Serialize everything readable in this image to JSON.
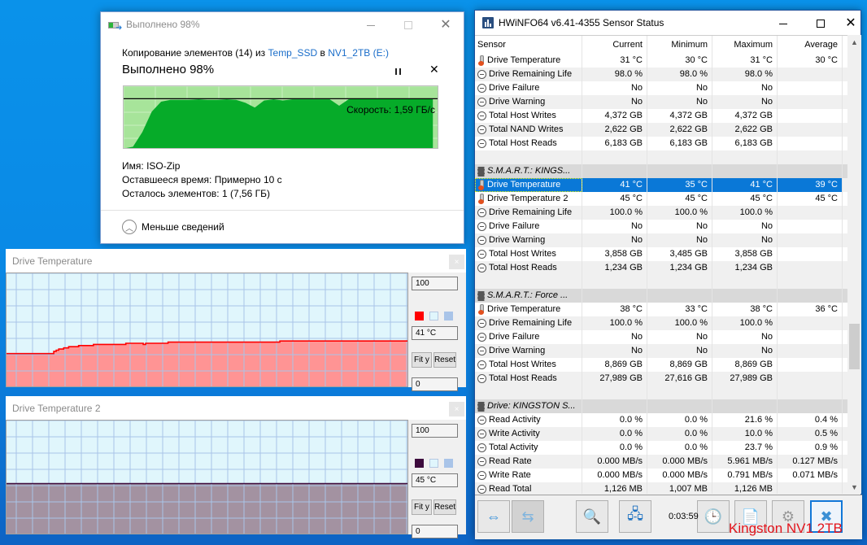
{
  "copy_dialog": {
    "title": "Выполнено 98%",
    "line_prefix": "Копирование элементов (14) из ",
    "source": "Temp_SSD",
    "line_mid": " в ",
    "destination": "NV1_2TB (E:)",
    "progress_title": "Выполнено 98%",
    "progress_percent": 98,
    "speed_label": "Скорость: 1,59 ГБ/с",
    "name_label": "Имя:",
    "name_value": "ISO-Zip",
    "time_label": "Оставшееся время:",
    "time_value": "Примерно 10 с",
    "items_label": "Осталось элементов:",
    "items_value": "1 (7,56 ГБ)",
    "less_details": "Меньше сведений",
    "speed_graph_fraction": [
      0.02,
      0.05,
      0.3,
      0.65,
      0.82,
      0.85,
      0.85,
      0.85,
      0.86,
      0.85,
      0.85,
      0.86,
      0.85,
      0.8,
      0.72,
      0.84,
      0.86,
      0.84,
      0.86,
      0.86,
      0.86,
      0.86,
      0.86,
      0.75,
      0.86,
      0.87,
      0.87,
      0.87,
      0.87,
      0.87,
      0.87,
      0.87,
      0.87,
      0.87
    ],
    "colors": {
      "graph_bg": "#a7e49a",
      "graph_fill": "#06ab29",
      "link": "#1a6dc9"
    }
  },
  "graph_windows": [
    {
      "title": "Drive Temperature",
      "max": "100",
      "current": "41 °C",
      "min": "0",
      "fit_label": "Fit y",
      "reset_label": "Reset",
      "line_color": "#ff0000",
      "fill_color": "#ff9494",
      "values": [
        30,
        30,
        30,
        30,
        30,
        30,
        30,
        30,
        30,
        30,
        30,
        30,
        30,
        30,
        30,
        30,
        30,
        30,
        30,
        32,
        33,
        34,
        34,
        35,
        35,
        36,
        36,
        36,
        36,
        37,
        37,
        37,
        37,
        37,
        37,
        38,
        38,
        38,
        38,
        38,
        38,
        38,
        38,
        38,
        38,
        38,
        38,
        38,
        39,
        39,
        39,
        39,
        39,
        39,
        39,
        38,
        39,
        39,
        39,
        39,
        39,
        39,
        39,
        39,
        39,
        40,
        40,
        40,
        40,
        40,
        40,
        40,
        40,
        40,
        40,
        40,
        40,
        40,
        40,
        40,
        40,
        40,
        40,
        40,
        40,
        40,
        40,
        40,
        40,
        40,
        40,
        40,
        40,
        40,
        40,
        40,
        40,
        40,
        40,
        40,
        40,
        40,
        40,
        40,
        40,
        40,
        40,
        40,
        40,
        40,
        41,
        41,
        41,
        41,
        41,
        41,
        41,
        41,
        41,
        41,
        41,
        41,
        41,
        41,
        41,
        41,
        41,
        41,
        41,
        41,
        41,
        41,
        41,
        41,
        41,
        41,
        41,
        41,
        41,
        41,
        41,
        41,
        41,
        41,
        41,
        41,
        41,
        41,
        41,
        41,
        41,
        41,
        41,
        41,
        41,
        41,
        41,
        41,
        41,
        41,
        41,
        41
      ]
    },
    {
      "title": "Drive Temperature 2",
      "max": "100",
      "current": "45 °C",
      "min": "0",
      "fit_label": "Fit y",
      "reset_label": "Reset",
      "line_color": "#3c0a3c",
      "fill_color": "#a392a1",
      "values": [
        45,
        45,
        45,
        45,
        45,
        45,
        45,
        45,
        45,
        45,
        45,
        45,
        45,
        45,
        45,
        45,
        45,
        45,
        45,
        45
      ]
    }
  ],
  "hwinfo": {
    "title": "HWiNFO64 v6.41-4355 Sensor Status",
    "columns": [
      "Sensor",
      "Current",
      "Minimum",
      "Maximum",
      "Average"
    ],
    "rows": [
      {
        "type": "data",
        "icon": "therm",
        "name": "Drive Temperature",
        "cur": "31 °C",
        "min": "30 °C",
        "max": "31 °C",
        "avg": "30 °C"
      },
      {
        "type": "data",
        "icon": "clock",
        "name": "Drive Remaining Life",
        "cur": "98.0 %",
        "min": "98.0 %",
        "max": "98.0 %",
        "avg": ""
      },
      {
        "type": "data",
        "icon": "clock",
        "name": "Drive Failure",
        "cur": "No",
        "min": "No",
        "max": "No",
        "avg": ""
      },
      {
        "type": "data",
        "icon": "clock",
        "name": "Drive Warning",
        "cur": "No",
        "min": "No",
        "max": "No",
        "avg": ""
      },
      {
        "type": "data",
        "icon": "clock",
        "name": "Total Host Writes",
        "cur": "4,372 GB",
        "min": "4,372 GB",
        "max": "4,372 GB",
        "avg": ""
      },
      {
        "type": "data",
        "icon": "clock",
        "name": "Total NAND Writes",
        "cur": "2,622 GB",
        "min": "2,622 GB",
        "max": "2,622 GB",
        "avg": ""
      },
      {
        "type": "data",
        "icon": "clock",
        "name": "Total Host Reads",
        "cur": "6,183 GB",
        "min": "6,183 GB",
        "max": "6,183 GB",
        "avg": ""
      },
      {
        "type": "blank"
      },
      {
        "type": "group",
        "name": "S.M.A.R.T.: KINGS..."
      },
      {
        "type": "data",
        "icon": "therm",
        "name": "Drive Temperature",
        "cur": "41 °C",
        "min": "35 °C",
        "max": "41 °C",
        "avg": "39 °C",
        "selected": true
      },
      {
        "type": "data",
        "icon": "therm",
        "name": "Drive Temperature 2",
        "cur": "45 °C",
        "min": "45 °C",
        "max": "45 °C",
        "avg": "45 °C"
      },
      {
        "type": "data",
        "icon": "clock",
        "name": "Drive Remaining Life",
        "cur": "100.0 %",
        "min": "100.0 %",
        "max": "100.0 %",
        "avg": ""
      },
      {
        "type": "data",
        "icon": "clock",
        "name": "Drive Failure",
        "cur": "No",
        "min": "No",
        "max": "No",
        "avg": ""
      },
      {
        "type": "data",
        "icon": "clock",
        "name": "Drive Warning",
        "cur": "No",
        "min": "No",
        "max": "No",
        "avg": ""
      },
      {
        "type": "data",
        "icon": "clock",
        "name": "Total Host Writes",
        "cur": "3,858 GB",
        "min": "3,485 GB",
        "max": "3,858 GB",
        "avg": ""
      },
      {
        "type": "data",
        "icon": "clock",
        "name": "Total Host Reads",
        "cur": "1,234 GB",
        "min": "1,234 GB",
        "max": "1,234 GB",
        "avg": ""
      },
      {
        "type": "blank"
      },
      {
        "type": "group",
        "name": "S.M.A.R.T.: Force ..."
      },
      {
        "type": "data",
        "icon": "therm",
        "name": "Drive Temperature",
        "cur": "38 °C",
        "min": "33 °C",
        "max": "38 °C",
        "avg": "36 °C"
      },
      {
        "type": "data",
        "icon": "clock",
        "name": "Drive Remaining Life",
        "cur": "100.0 %",
        "min": "100.0 %",
        "max": "100.0 %",
        "avg": ""
      },
      {
        "type": "data",
        "icon": "clock",
        "name": "Drive Failure",
        "cur": "No",
        "min": "No",
        "max": "No",
        "avg": ""
      },
      {
        "type": "data",
        "icon": "clock",
        "name": "Drive Warning",
        "cur": "No",
        "min": "No",
        "max": "No",
        "avg": ""
      },
      {
        "type": "data",
        "icon": "clock",
        "name": "Total Host Writes",
        "cur": "8,869 GB",
        "min": "8,869 GB",
        "max": "8,869 GB",
        "avg": ""
      },
      {
        "type": "data",
        "icon": "clock",
        "name": "Total Host Reads",
        "cur": "27,989 GB",
        "min": "27,616 GB",
        "max": "27,989 GB",
        "avg": ""
      },
      {
        "type": "blank"
      },
      {
        "type": "group",
        "name": "Drive: KINGSTON S..."
      },
      {
        "type": "data",
        "icon": "clock",
        "name": "Read Activity",
        "cur": "0.0 %",
        "min": "0.0 %",
        "max": "21.6 %",
        "avg": "0.4 %"
      },
      {
        "type": "data",
        "icon": "clock",
        "name": "Write Activity",
        "cur": "0.0 %",
        "min": "0.0 %",
        "max": "10.0 %",
        "avg": "0.5 %"
      },
      {
        "type": "data",
        "icon": "clock",
        "name": "Total Activity",
        "cur": "0.0 %",
        "min": "0.0 %",
        "max": "23.7 %",
        "avg": "0.9 %"
      },
      {
        "type": "data",
        "icon": "clock",
        "name": "Read Rate",
        "cur": "0.000 MB/s",
        "min": "0.000 MB/s",
        "max": "5.961 MB/s",
        "avg": "0.127 MB/s"
      },
      {
        "type": "data",
        "icon": "clock",
        "name": "Write Rate",
        "cur": "0.000 MB/s",
        "min": "0.000 MB/s",
        "max": "0.791 MB/s",
        "avg": "0.071 MB/s"
      },
      {
        "type": "data",
        "icon": "clock",
        "name": "Read Total",
        "cur": "1,126 MB",
        "min": "1,007 MB",
        "max": "1,126 MB",
        "avg": ""
      }
    ],
    "timer": "0:03:59",
    "toolbar": [
      {
        "name": "expand-columns-button",
        "icon": "arrows-out-icon",
        "glyph": "⇔",
        "color": "#2a8ad8"
      },
      {
        "name": "collapse-columns-button",
        "icon": "arrows-in-icon",
        "glyph": "⇆",
        "color": "#7fb4de",
        "disabled": true
      },
      {
        "name": "sensor-search-button",
        "icon": "monitor-search-icon",
        "glyph": "🔍",
        "color": "#1a5fb0"
      },
      {
        "name": "network-button",
        "icon": "network-computers-icon",
        "glyph": "🖧",
        "color": "#1a6fc0"
      },
      {
        "name": "clock-button",
        "icon": "clock-icon",
        "glyph": "🕒",
        "color": "#222"
      },
      {
        "name": "add-log-button",
        "icon": "log-add-icon",
        "glyph": "📄",
        "color": "#777"
      },
      {
        "name": "settings-button",
        "icon": "gear-icon",
        "glyph": "⚙",
        "color": "#999"
      },
      {
        "name": "close-sensors-button",
        "icon": "close-x-icon",
        "glyph": "✖",
        "color": "#3b8fd4",
        "active": true
      }
    ]
  },
  "overlay_label": "Kingston NV1 2TB"
}
